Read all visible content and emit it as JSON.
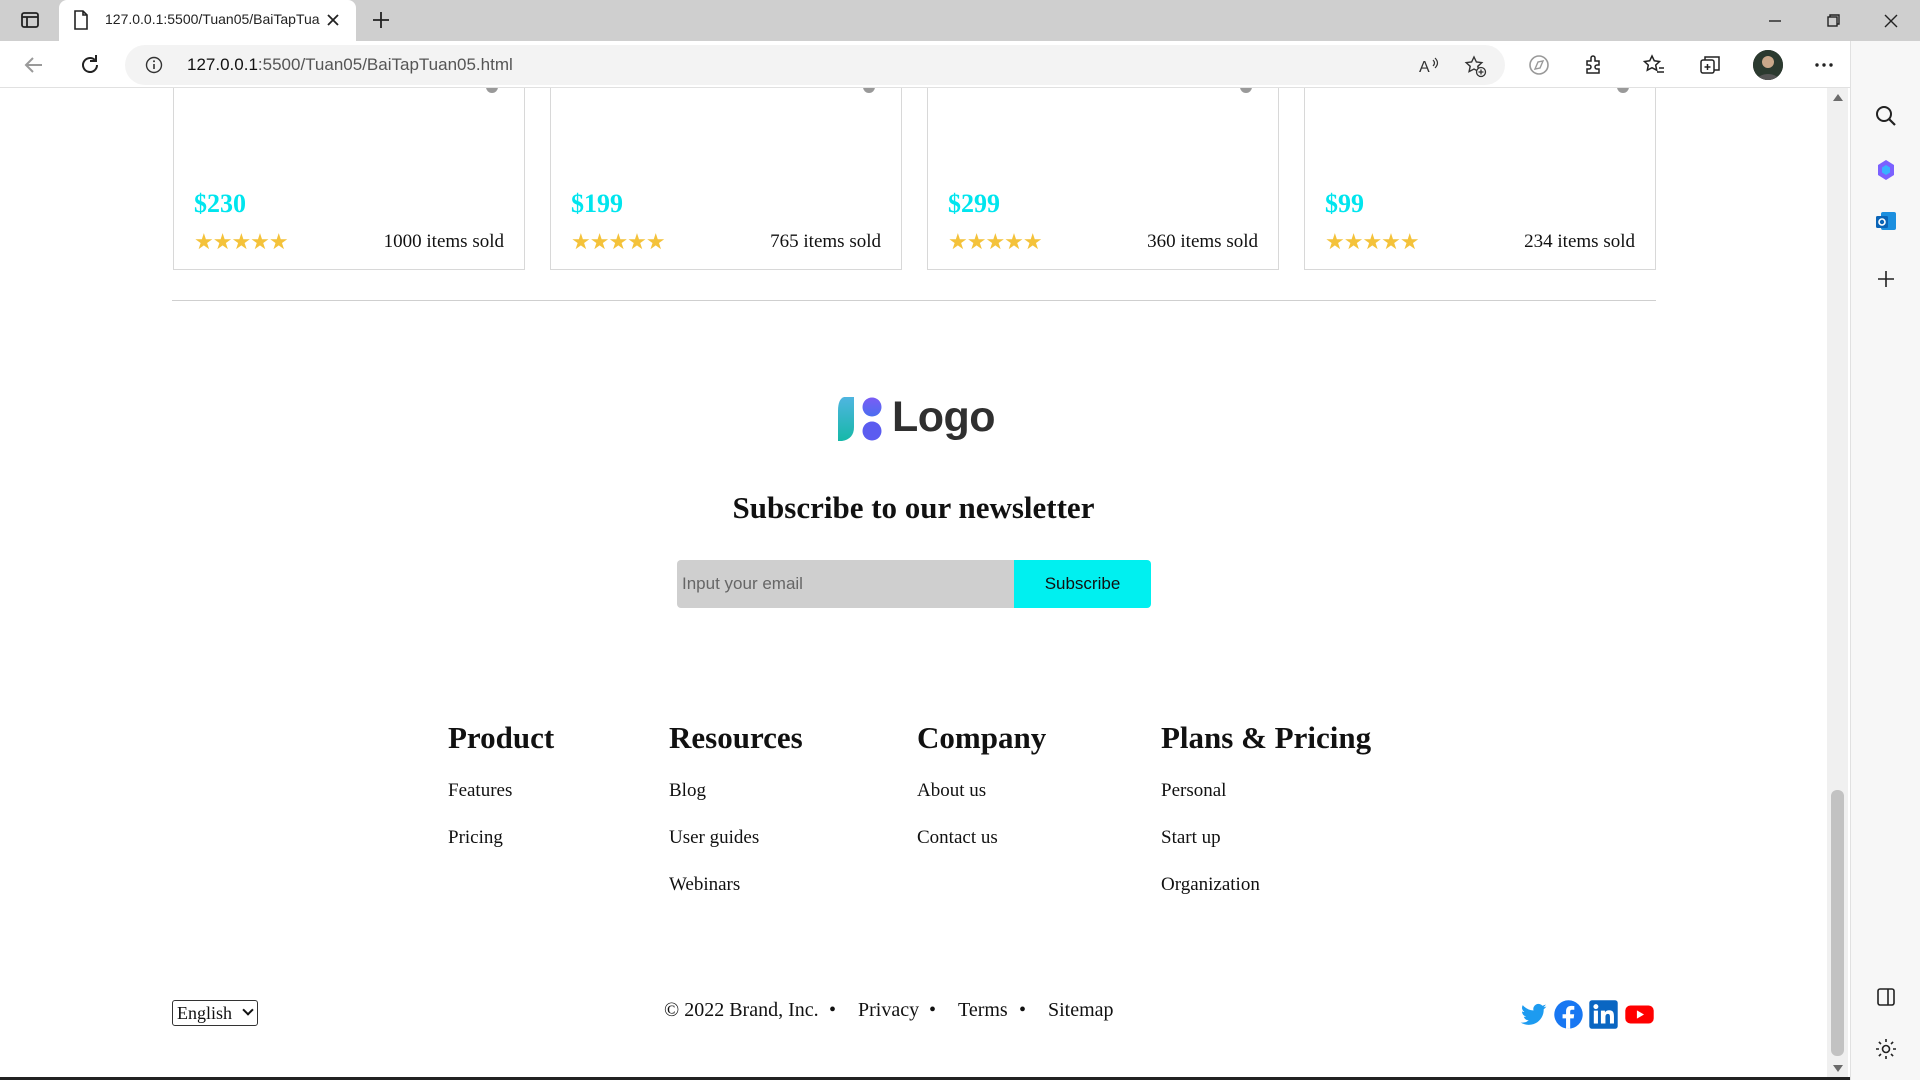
{
  "browser": {
    "tab_title": "127.0.0.1:5500/Tuan05/BaiTapTuan05.html",
    "url_host": "127.0.0.1",
    "url_path": ":5500/Tuan05/BaiTapTuan05.html"
  },
  "products": [
    {
      "price": "$230",
      "sold": "1000 items sold",
      "rating": 5
    },
    {
      "price": "$199",
      "sold": "765 items sold",
      "rating": 5
    },
    {
      "price": "$299",
      "sold": "360 items sold",
      "rating": 5
    },
    {
      "price": "$99",
      "sold": "234 items sold",
      "rating": 5
    }
  ],
  "stars": "★★★★★",
  "logo": {
    "text": "Logo"
  },
  "newsletter": {
    "title": "Subscribe to our newsletter",
    "placeholder": "Input your email",
    "button": "Subscribe"
  },
  "footer": {
    "columns": [
      {
        "title": "Product",
        "links": [
          "Features",
          "Pricing"
        ]
      },
      {
        "title": "Resources",
        "links": [
          "Blog",
          "User guides",
          "Webinars"
        ]
      },
      {
        "title": "Company",
        "links": [
          "About us",
          "Contact us"
        ]
      },
      {
        "title": "Plans & Pricing",
        "links": [
          "Personal",
          "Start up",
          "Organization"
        ]
      }
    ],
    "language": "English",
    "copyright": "© 2022 Brand, Inc.",
    "privacy": "Privacy",
    "terms": "Terms",
    "sitemap": "Sitemap",
    "bullet": "•"
  },
  "colors": {
    "price": "#00e5ee",
    "subscribe": "#00f0f0",
    "star": "#f4c23a",
    "twitter": "#1d9bf0",
    "facebook": "#1877f2",
    "linkedin": "#0a66c2",
    "youtube": "#ff0000"
  }
}
